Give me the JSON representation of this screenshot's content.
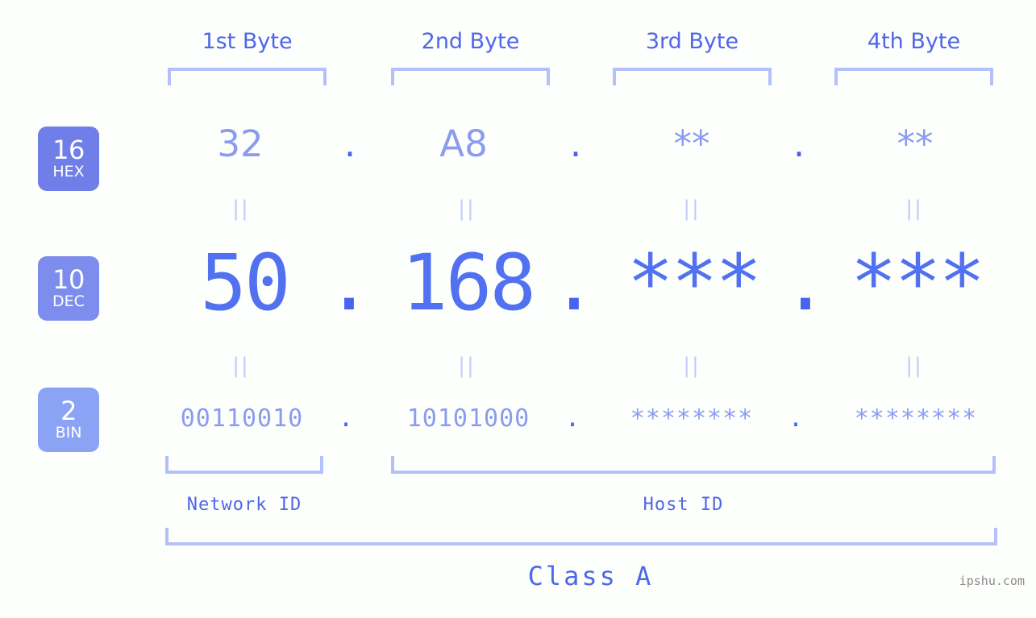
{
  "background": "#fdfffc",
  "accent": "#5271f0",
  "accent_light": "#8b9bf0",
  "accent_pale": "#b3c0fb",
  "bracket_color": "#b3c0fb",
  "header": {
    "bytes": [
      {
        "label": "1st Byte"
      },
      {
        "label": "2nd Byte"
      },
      {
        "label": "3rd Byte"
      },
      {
        "label": "4th Byte"
      }
    ]
  },
  "rows": [
    {
      "id": "hex",
      "badge": {
        "num": "16",
        "base": "HEX",
        "color": "#6f7ee8"
      },
      "values": [
        "32",
        "A8",
        "**",
        "**"
      ],
      "separator": "."
    },
    {
      "id": "dec",
      "badge": {
        "num": "10",
        "base": "DEC",
        "color": "#7d8ded"
      },
      "values": [
        "50",
        "168",
        "***",
        "***"
      ],
      "separator": "."
    },
    {
      "id": "bin",
      "badge": {
        "num": "2",
        "base": "BIN",
        "color": "#8ba3f5"
      },
      "values": [
        "00110010",
        "10101000",
        "********",
        "********"
      ],
      "separator": "."
    }
  ],
  "equals_marks": {
    "glyph": "||",
    "color": "#c3cdf8",
    "count_per_row_gap": 4
  },
  "sections": [
    {
      "name": "network",
      "label": "Network ID"
    },
    {
      "name": "host",
      "label": "Host ID"
    }
  ],
  "class": {
    "label": "Class A"
  },
  "watermark": {
    "text": "ipshu.com"
  }
}
